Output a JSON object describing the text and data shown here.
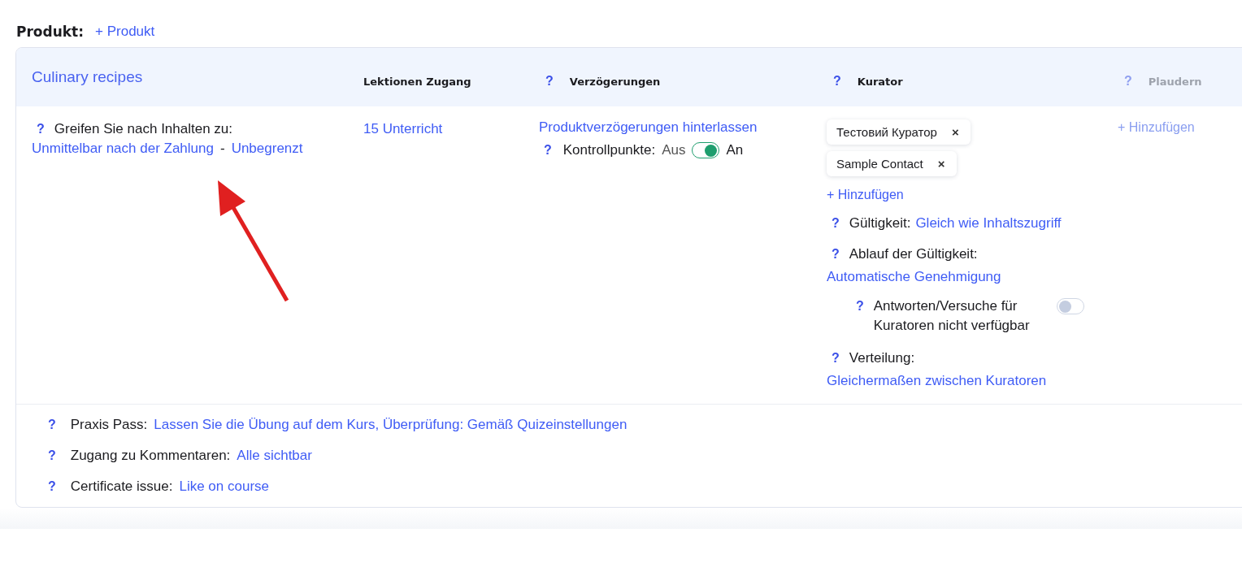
{
  "section": {
    "label": "Produkt:",
    "add_link": "+ Produkt"
  },
  "product": {
    "name": "Culinary recipes",
    "columns": [
      {
        "label": "Lektionen Zugang",
        "disabled": false
      },
      {
        "help": "?",
        "label": "Verzögerungen",
        "disabled": false
      },
      {
        "help": "?",
        "label": "Kurator",
        "disabled": false
      },
      {
        "help": "?",
        "label": "Plaudern",
        "disabled": true
      }
    ],
    "access": {
      "help": "?",
      "label": "Greifen Sie nach Inhalten zu:",
      "value": "Unmittelbar nach der Zahlung",
      "separator": "-",
      "limit": "Unbegrenzt"
    },
    "lessons": "15 Unterricht",
    "delays": {
      "link": "Produktverzögerungen hinterlassen",
      "checkpoints": {
        "help": "?",
        "label": "Kontrollpunkte:",
        "off_label": "Aus",
        "on_label": "An",
        "on": true
      }
    },
    "curators": {
      "tags": [
        {
          "name": "Тестовий Куратор",
          "remove": "×"
        },
        {
          "name": "Sample Contact",
          "remove": "×"
        }
      ],
      "add": "+ Hinzufügen",
      "settings": [
        {
          "kind": "value",
          "help": "?",
          "label": "Gültigkeit:",
          "value": "Gleich wie Inhaltszugriff"
        },
        {
          "kind": "value",
          "help": "?",
          "label": "Ablauf der Gültigkeit:",
          "value": "Automatische Genehmigung"
        },
        {
          "kind": "toggle",
          "help": "?",
          "label": "Antworten/Versuche für Kuratoren nicht verfügbar",
          "on": false
        },
        {
          "kind": "value",
          "help": "?",
          "label": "Verteilung:",
          "value": "Gleichermaßen zwischen Kuratoren"
        }
      ]
    },
    "chat": {
      "add": "+ Hinzufügen",
      "disabled": true
    },
    "footer": [
      {
        "help": "?",
        "label": "Praxis Pass:",
        "value": "Lassen Sie die Übung auf dem Kurs, Überprüfung: Gemäß Quizeinstellungen"
      },
      {
        "help": "?",
        "label": "Zugang zu Kommentaren:",
        "value": "Alle sichtbar"
      },
      {
        "help": "?",
        "label": "Certificate issue:",
        "value": "Like on course"
      }
    ]
  }
}
